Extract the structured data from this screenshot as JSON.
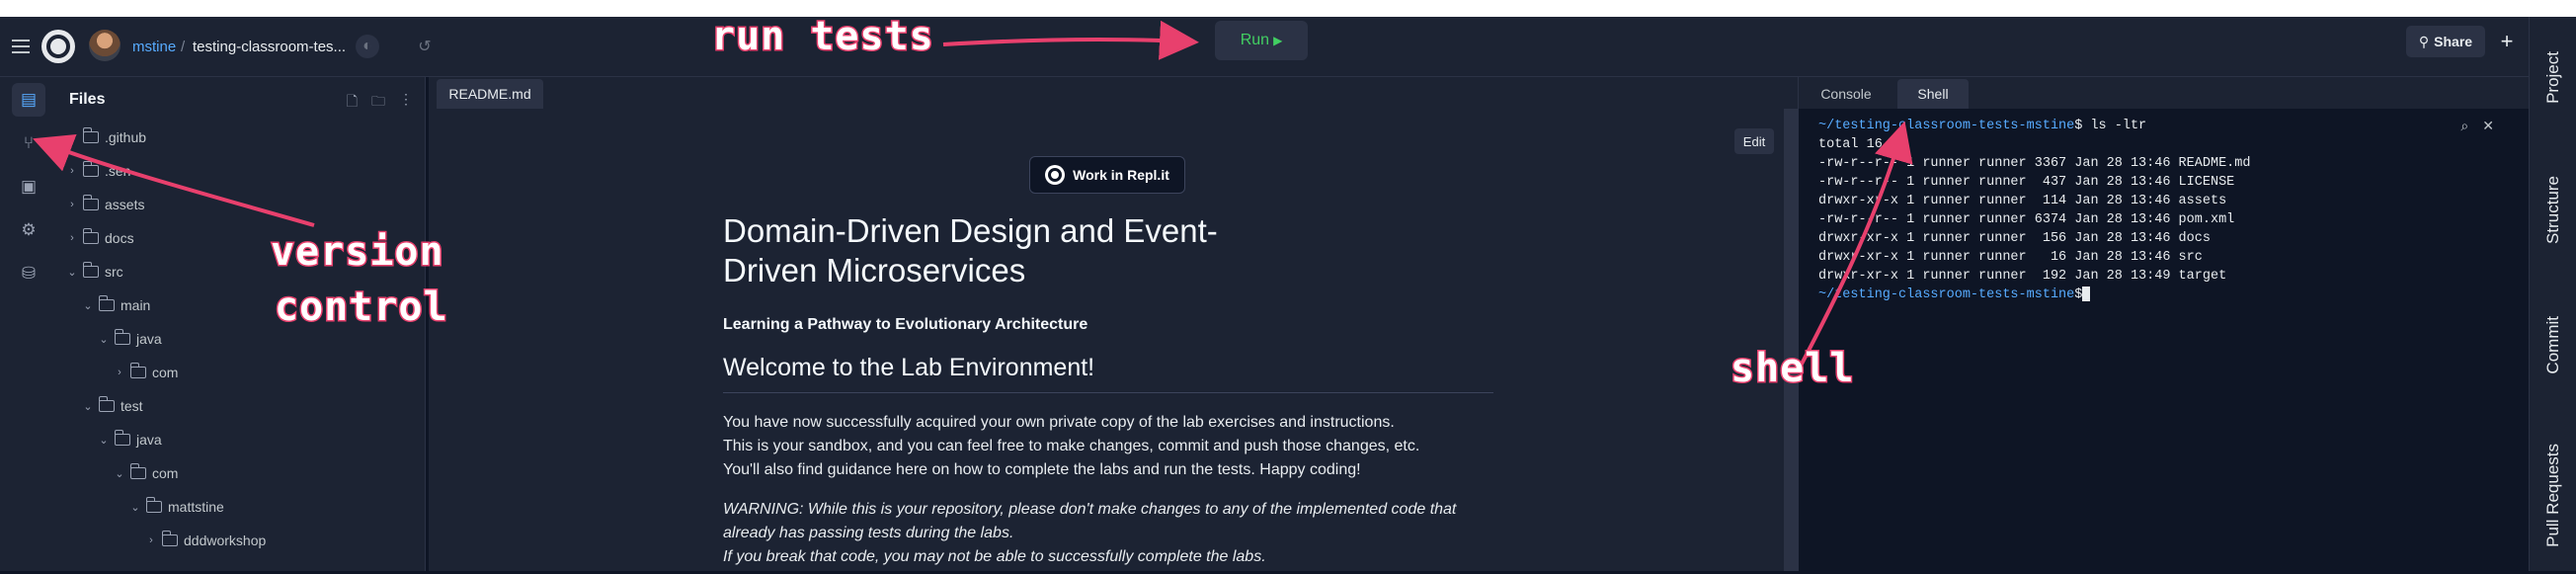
{
  "topbar": {
    "user": "mstine",
    "separator": "/",
    "repl_name": "testing-classroom-tes...",
    "run_label": "Run",
    "run_glyph": "▶",
    "share_label": "Share",
    "share_glyph": "⚲",
    "plus_glyph": "+"
  },
  "files_panel": {
    "title": "Files",
    "tree": [
      {
        "name": ".github",
        "chevron": ""
      },
      {
        "name": ".sen",
        "chevron": "›"
      },
      {
        "name": "assets",
        "chevron": "›"
      },
      {
        "name": "docs",
        "chevron": "›"
      },
      {
        "name": "src",
        "chevron": "⌄"
      },
      {
        "name": "main",
        "chevron": "⌄"
      },
      {
        "name": "java",
        "chevron": "⌄"
      },
      {
        "name": "com",
        "chevron": "›"
      },
      {
        "name": "test",
        "chevron": "⌄"
      },
      {
        "name": "java",
        "chevron": "⌄"
      },
      {
        "name": "com",
        "chevron": "⌄"
      },
      {
        "name": "mattstine",
        "chevron": "⌄"
      },
      {
        "name": "dddworkshop",
        "chevron": "›"
      }
    ]
  },
  "editor": {
    "tab_label": "README.md",
    "edit_label": "Edit",
    "work_button": "Work in Repl.it",
    "h1": "Domain-Driven Design and Event-Driven Microservices",
    "subtitle": "Learning a Pathway to Evolutionary Architecture",
    "h2": "Welcome to the Lab Environment!",
    "p1": [
      "You have now successfully acquired your own private copy of the lab exercises and instructions.",
      "This is your sandbox, and you can feel free to make changes, commit and push those changes, etc.",
      "You'll also find guidance here on how to complete the labs and run the tests. Happy coding!"
    ],
    "p2": [
      "WARNING: While this is your repository, please don't make changes to any of the implemented code that",
      "already has passing tests during the labs.",
      "If you break that code, you may not be able to successfully complete the labs."
    ]
  },
  "terminal": {
    "tabs": [
      "Console",
      "Shell"
    ],
    "prompt": "~/testing-classroom-tests-mstine",
    "command": "$ ls -ltr",
    "output": [
      "total 16",
      "-rw-r--r-- 1 runner runner 3367 Jan 28 13:46 README.md",
      "-rw-r--r-- 1 runner runner  437 Jan 28 13:46 LICENSE",
      "drwxr-xr-x 1 runner runner  114 Jan 28 13:46 assets",
      "-rw-r--r-- 1 runner runner 6374 Jan 28 13:46 pom.xml",
      "drwxr-xr-x 1 runner runner  156 Jan 28 13:46 docs",
      "drwxr-xr-x 1 runner runner   16 Jan 28 13:46 src",
      "drwxr-xr-x 1 runner runner  192 Jan 28 13:49 target"
    ],
    "end_prompt": "~/testing-classroom-tests-mstine",
    "end_suffix": "$"
  },
  "right_sidebar": {
    "tabs": [
      "Project",
      "Structure",
      "Commit",
      "Pull Requests"
    ]
  },
  "annotations": {
    "run_tests": "run tests",
    "version_control_1": "version",
    "version_control_2": "control",
    "shell": "shell"
  },
  "colors": {
    "background": "#0e1525",
    "panel": "#1c2333",
    "accent_blue": "#57abff",
    "run_green": "#42cf62",
    "annotation_pink": "#e8406d"
  }
}
